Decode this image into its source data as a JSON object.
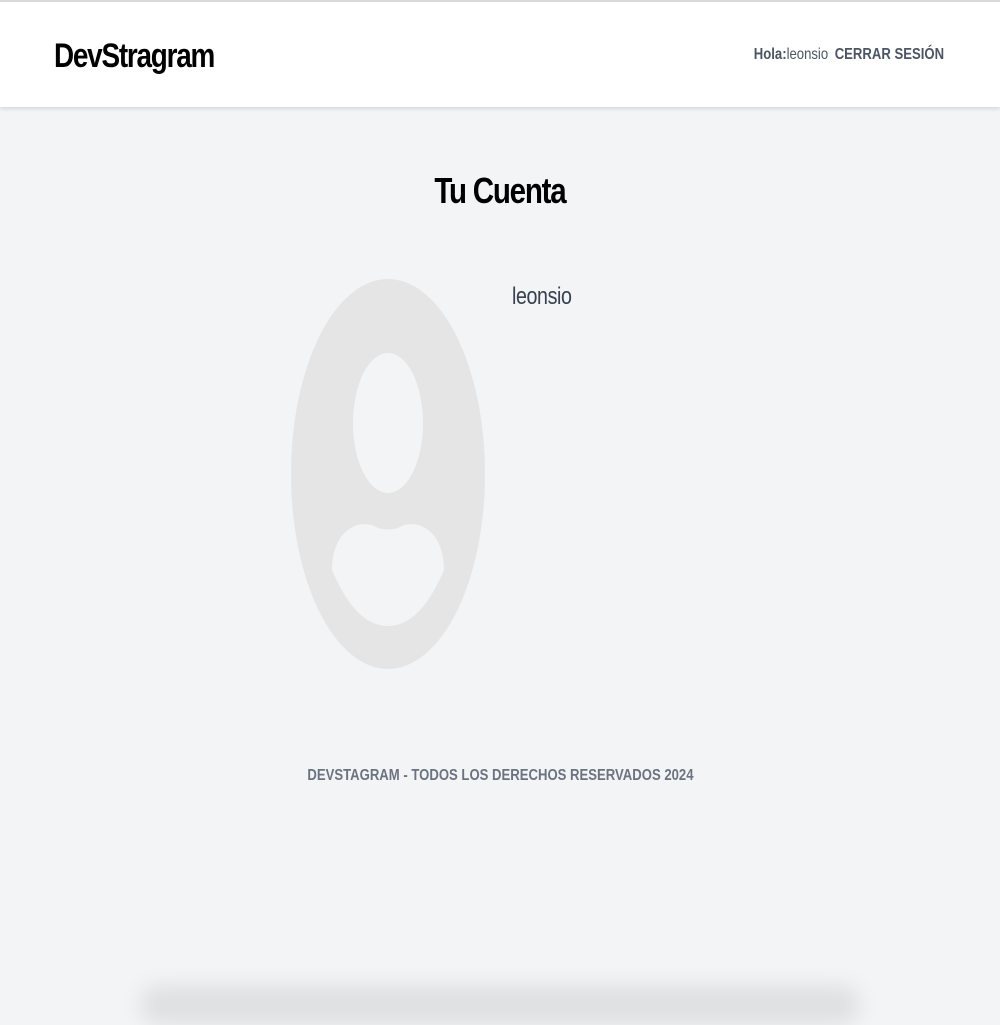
{
  "header": {
    "logo": "DevStragram",
    "greeting_label": "Hola:",
    "greeting_user": "leonsio",
    "logout_label": "CERRAR SESIÓN"
  },
  "main": {
    "title": "Tu Cuenta",
    "username": "leonsio",
    "avatar_icon": "default-user-avatar-icon"
  },
  "footer": {
    "text": "DEVSTAGRAM - TODOS LOS DERECHOS RESERVADOS 2024"
  },
  "colors": {
    "background": "#f3f4f6",
    "header_bg": "#ffffff",
    "avatar_gray": "#e5e5e5",
    "muted_text": "#6b7280"
  }
}
